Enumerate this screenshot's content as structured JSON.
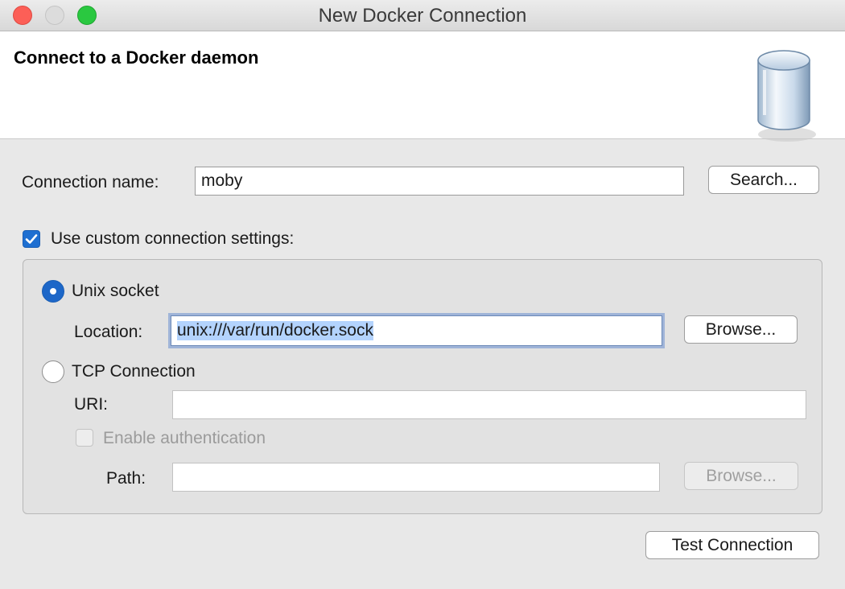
{
  "window": {
    "title": "New Docker Connection",
    "controls": [
      "close",
      "minimize",
      "zoom"
    ]
  },
  "banner": {
    "title": "Connect to a Docker daemon",
    "icon": "database-cylinder-icon"
  },
  "connection": {
    "name_label": "Connection name:",
    "name_value": "moby",
    "search_button": "Search..."
  },
  "custom_settings": {
    "label": "Use custom connection settings:",
    "checked": true
  },
  "unix_socket": {
    "label": "Unix socket",
    "selected": true,
    "location_label": "Location:",
    "location_value": "unix:///var/run/docker.sock",
    "browse_button": "Browse..."
  },
  "tcp": {
    "label": "TCP Connection",
    "selected": false,
    "uri_label": "URI:",
    "uri_value": "",
    "enable_auth_label": "Enable authentication",
    "enable_auth_checked": false,
    "path_label": "Path:",
    "path_value": "",
    "browse_button": "Browse..."
  },
  "footer": {
    "test_button": "Test Connection"
  },
  "colors": {
    "accent": "#1e6fd1",
    "selection": "#b3d3fd",
    "close": "#fc5f57",
    "zoom": "#2ac840"
  }
}
